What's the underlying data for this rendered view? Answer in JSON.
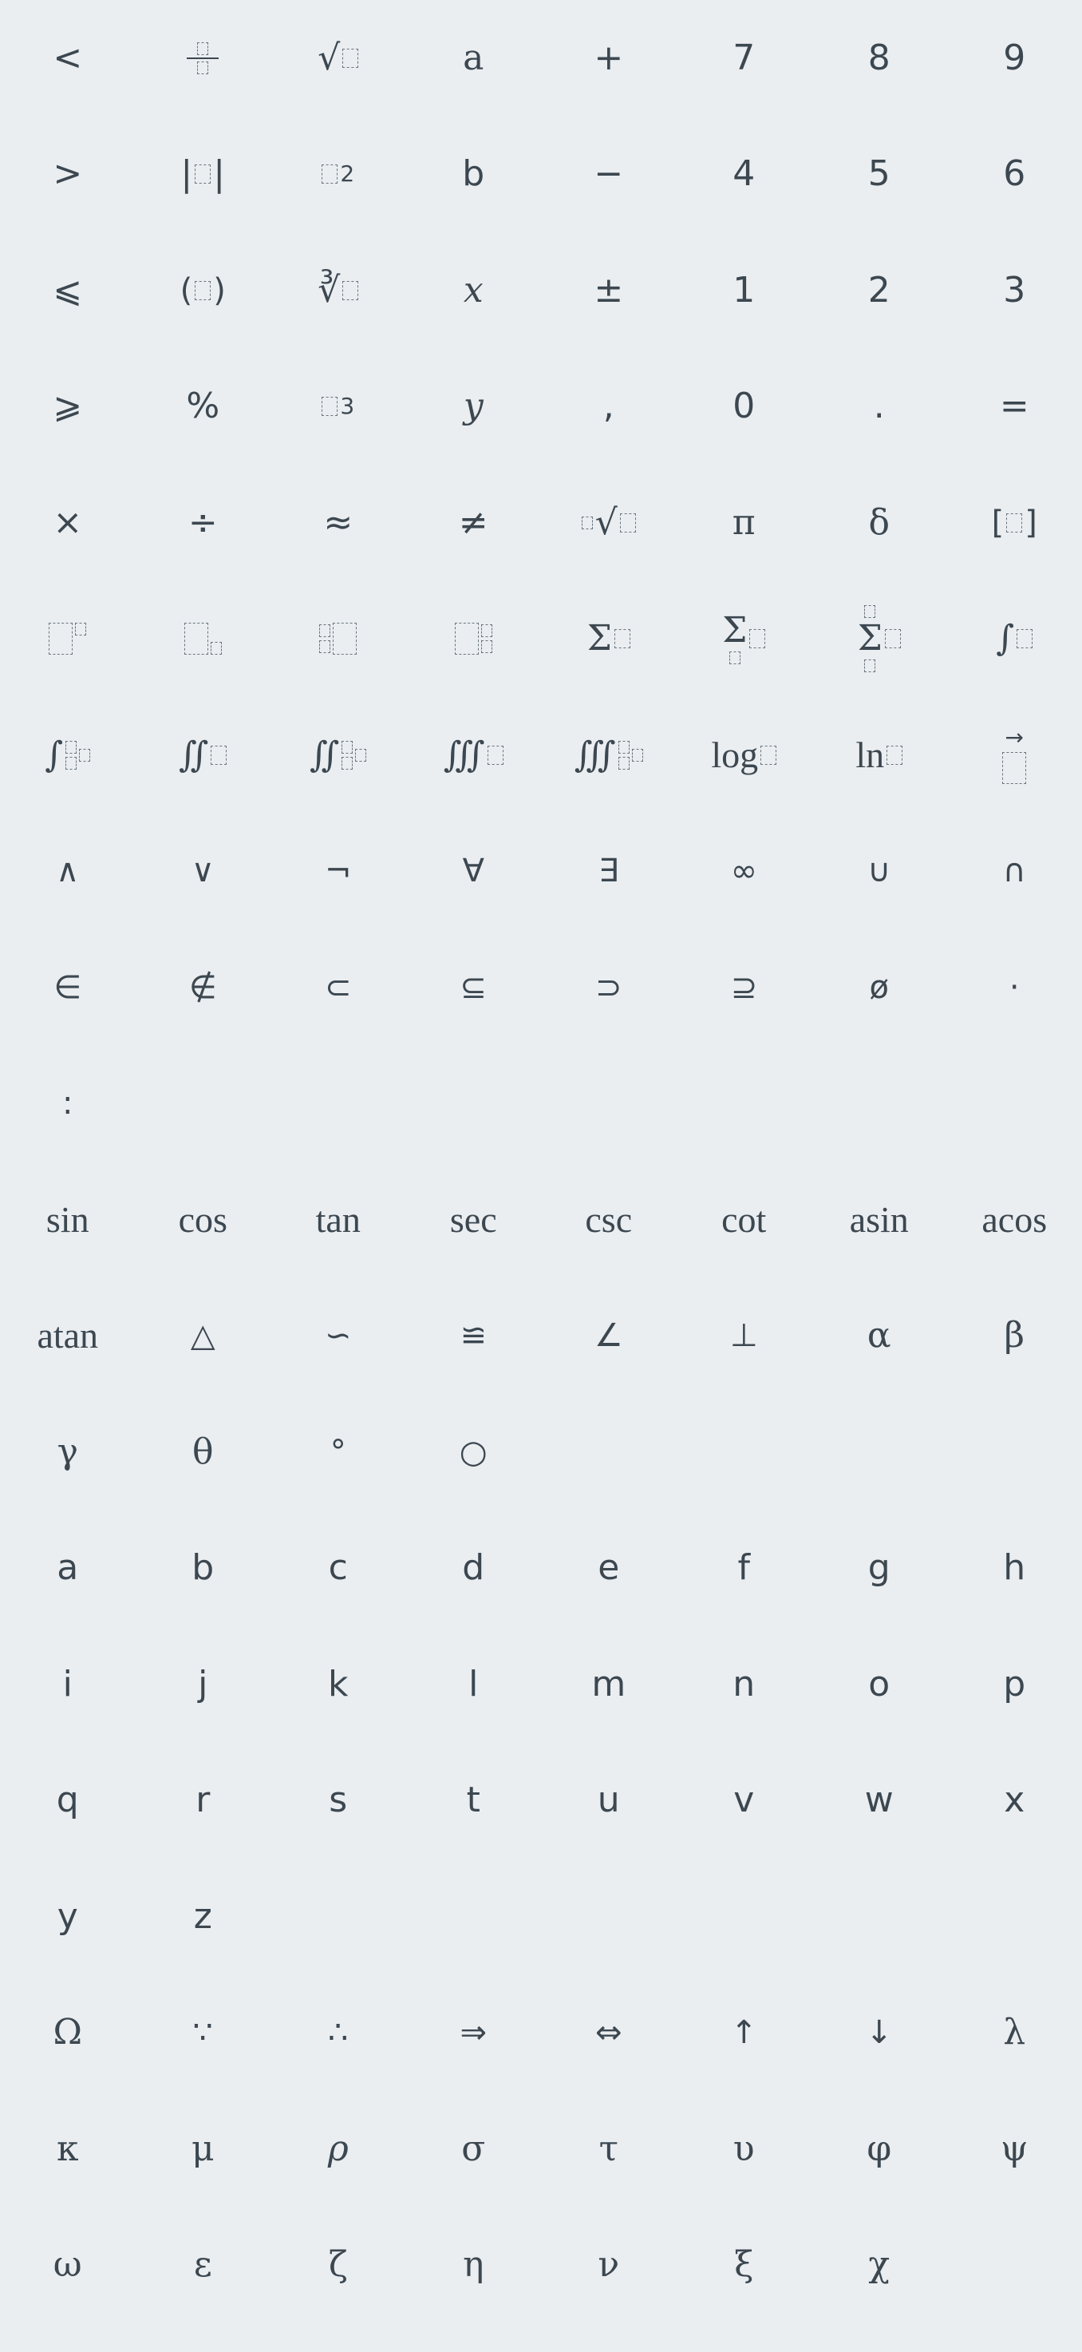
{
  "basic_keys": [
    "<",
    "",
    "",
    "a",
    "+",
    "7",
    "8",
    "9",
    ">",
    "",
    "",
    "b",
    "−",
    "4",
    "5",
    "6",
    "⩽",
    "",
    "",
    "x",
    "±",
    "1",
    "2",
    "3",
    "⩾",
    "%",
    "",
    "y",
    ",",
    "0",
    ".",
    "="
  ],
  "operator_keys": [
    "×",
    "÷",
    "≈",
    "≠",
    "",
    "π",
    "δ",
    ""
  ],
  "template_labels": {
    "sqrt": "√",
    "cbrt": "∛",
    "nthroot": "√",
    "sum": "Σ",
    "integral": "∫",
    "double_integral": "∬",
    "triple_integral": "∭",
    "log": "log",
    "ln": "ln",
    "sq": "2",
    "cube": "3",
    "cube_index": "3"
  },
  "logic_keys": [
    "∧",
    "∨",
    "¬",
    "∀",
    "∃",
    "∞",
    "∪",
    "∩",
    "∈",
    "∉",
    "⊂",
    "⊆",
    "⊃",
    "⊇",
    "ø",
    "·",
    ":"
  ],
  "trig_keys": [
    "sin",
    "cos",
    "tan",
    "sec",
    "csc",
    "cot",
    "asin",
    "acos",
    "atan",
    "△",
    "∽",
    "≌",
    "∠",
    "⊥",
    "α",
    "β",
    "γ",
    "θ",
    "°",
    "○"
  ],
  "letter_keys": [
    "a",
    "b",
    "c",
    "d",
    "e",
    "f",
    "g",
    "h",
    "i",
    "j",
    "k",
    "l",
    "m",
    "n",
    "o",
    "p",
    "q",
    "r",
    "s",
    "t",
    "u",
    "v",
    "w",
    "x",
    "y",
    "z"
  ],
  "greek_keys": [
    "Ω",
    "∵",
    "∴",
    "⇒",
    "⇔",
    "↑",
    "↓",
    "λ",
    "κ",
    "μ",
    "ρ",
    "σ",
    "τ",
    "υ",
    "φ",
    "ψ",
    "ω",
    "ε",
    "ζ",
    "η",
    "ν",
    "ξ",
    "χ"
  ]
}
